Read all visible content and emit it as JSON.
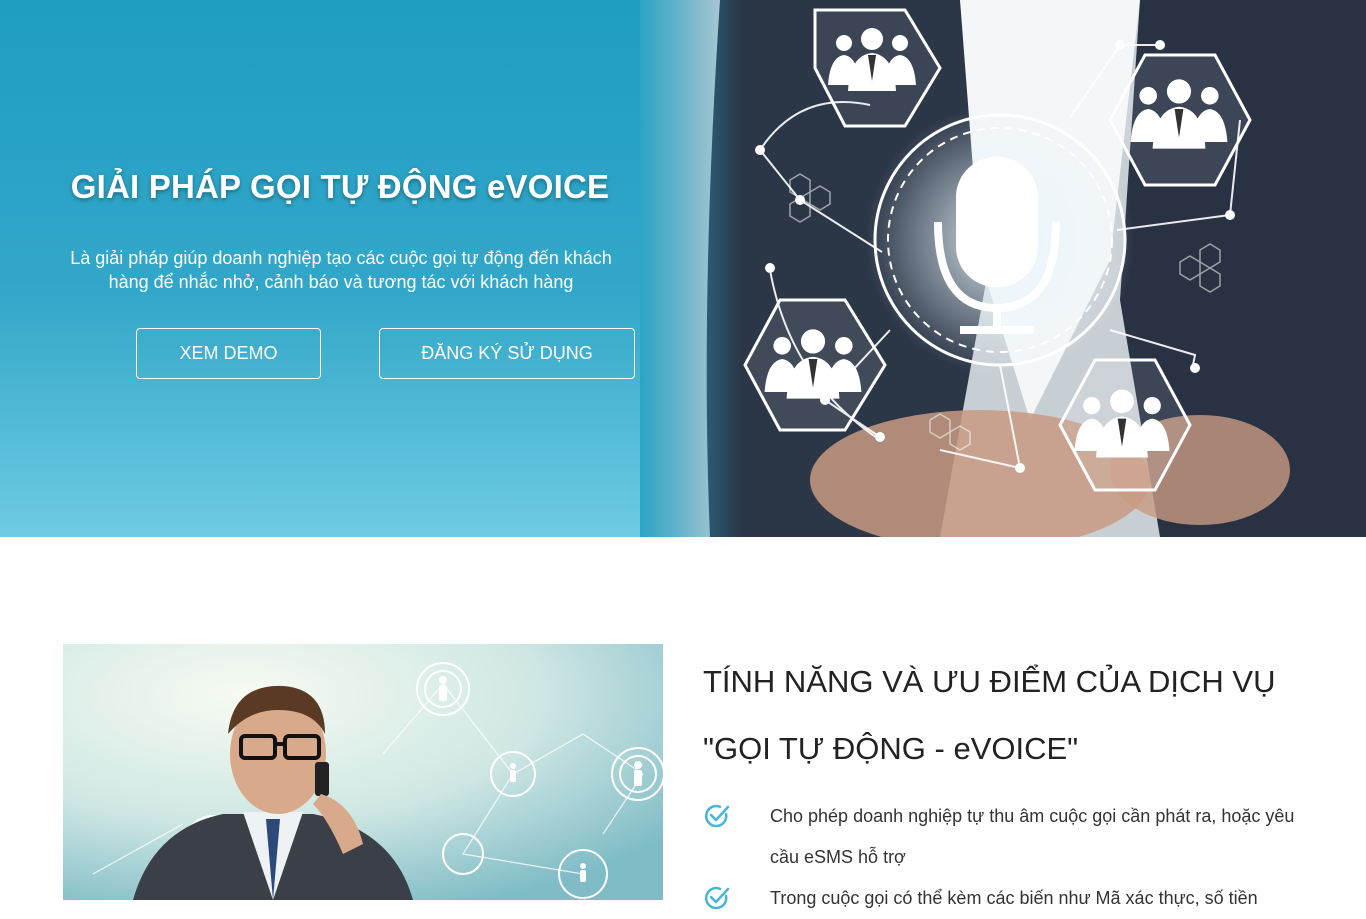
{
  "hero": {
    "title": "GIẢI PHÁP GỌI TỰ ĐỘNG eVOICE",
    "description": "Là giải pháp giúp doanh nghiệp tạo các cuộc gọi tự động đến khách hàng để nhắc nhở, cảnh báo và tương tác với khách hàng",
    "buttons": {
      "demo": "XEM DEMO",
      "register": "ĐĂNG KÝ SỬ DỤNG"
    },
    "image": {
      "subject": "businessman touching microphone hub connected to customer group hexagons",
      "icons": [
        "microphone-icon",
        "user-group-icon"
      ]
    },
    "colors": {
      "gradient_top": "#1f9dc2",
      "gradient_bottom": "#6ecbe2"
    }
  },
  "features": {
    "title": "TÍNH NĂNG VÀ ƯU ĐIỂM CỦA DỊCH VỤ \"GỌI TỰ ĐỘNG - eVOICE\"",
    "items": [
      {
        "text": "Cho phép doanh nghiệp tự thu âm cuộc gọi cần phát ra, hoặc yêu cầu eSMS hỗ trợ",
        "icon": "check-circle-icon"
      },
      {
        "text": "Trong cuộc gọi có thể kèm các biến như Mã xác thực, số tiền",
        "icon": "check-circle-icon"
      }
    ],
    "image": {
      "subject": "man with glasses on phone call with network of people icons"
    },
    "colors": {
      "check": "#45b6d6"
    }
  }
}
